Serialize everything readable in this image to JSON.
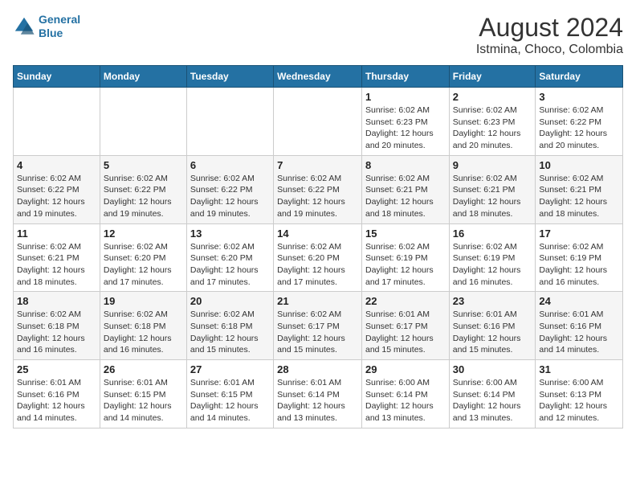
{
  "header": {
    "logo_line1": "General",
    "logo_line2": "Blue",
    "main_title": "August 2024",
    "subtitle": "Istmina, Choco, Colombia"
  },
  "calendar": {
    "days_of_week": [
      "Sunday",
      "Monday",
      "Tuesday",
      "Wednesday",
      "Thursday",
      "Friday",
      "Saturday"
    ],
    "weeks": [
      [
        {
          "day": "",
          "info": ""
        },
        {
          "day": "",
          "info": ""
        },
        {
          "day": "",
          "info": ""
        },
        {
          "day": "",
          "info": ""
        },
        {
          "day": "1",
          "info": "Sunrise: 6:02 AM\nSunset: 6:23 PM\nDaylight: 12 hours\nand 20 minutes."
        },
        {
          "day": "2",
          "info": "Sunrise: 6:02 AM\nSunset: 6:23 PM\nDaylight: 12 hours\nand 20 minutes."
        },
        {
          "day": "3",
          "info": "Sunrise: 6:02 AM\nSunset: 6:22 PM\nDaylight: 12 hours\nand 20 minutes."
        }
      ],
      [
        {
          "day": "4",
          "info": "Sunrise: 6:02 AM\nSunset: 6:22 PM\nDaylight: 12 hours\nand 19 minutes."
        },
        {
          "day": "5",
          "info": "Sunrise: 6:02 AM\nSunset: 6:22 PM\nDaylight: 12 hours\nand 19 minutes."
        },
        {
          "day": "6",
          "info": "Sunrise: 6:02 AM\nSunset: 6:22 PM\nDaylight: 12 hours\nand 19 minutes."
        },
        {
          "day": "7",
          "info": "Sunrise: 6:02 AM\nSunset: 6:22 PM\nDaylight: 12 hours\nand 19 minutes."
        },
        {
          "day": "8",
          "info": "Sunrise: 6:02 AM\nSunset: 6:21 PM\nDaylight: 12 hours\nand 18 minutes."
        },
        {
          "day": "9",
          "info": "Sunrise: 6:02 AM\nSunset: 6:21 PM\nDaylight: 12 hours\nand 18 minutes."
        },
        {
          "day": "10",
          "info": "Sunrise: 6:02 AM\nSunset: 6:21 PM\nDaylight: 12 hours\nand 18 minutes."
        }
      ],
      [
        {
          "day": "11",
          "info": "Sunrise: 6:02 AM\nSunset: 6:21 PM\nDaylight: 12 hours\nand 18 minutes."
        },
        {
          "day": "12",
          "info": "Sunrise: 6:02 AM\nSunset: 6:20 PM\nDaylight: 12 hours\nand 17 minutes."
        },
        {
          "day": "13",
          "info": "Sunrise: 6:02 AM\nSunset: 6:20 PM\nDaylight: 12 hours\nand 17 minutes."
        },
        {
          "day": "14",
          "info": "Sunrise: 6:02 AM\nSunset: 6:20 PM\nDaylight: 12 hours\nand 17 minutes."
        },
        {
          "day": "15",
          "info": "Sunrise: 6:02 AM\nSunset: 6:19 PM\nDaylight: 12 hours\nand 17 minutes."
        },
        {
          "day": "16",
          "info": "Sunrise: 6:02 AM\nSunset: 6:19 PM\nDaylight: 12 hours\nand 16 minutes."
        },
        {
          "day": "17",
          "info": "Sunrise: 6:02 AM\nSunset: 6:19 PM\nDaylight: 12 hours\nand 16 minutes."
        }
      ],
      [
        {
          "day": "18",
          "info": "Sunrise: 6:02 AM\nSunset: 6:18 PM\nDaylight: 12 hours\nand 16 minutes."
        },
        {
          "day": "19",
          "info": "Sunrise: 6:02 AM\nSunset: 6:18 PM\nDaylight: 12 hours\nand 16 minutes."
        },
        {
          "day": "20",
          "info": "Sunrise: 6:02 AM\nSunset: 6:18 PM\nDaylight: 12 hours\nand 15 minutes."
        },
        {
          "day": "21",
          "info": "Sunrise: 6:02 AM\nSunset: 6:17 PM\nDaylight: 12 hours\nand 15 minutes."
        },
        {
          "day": "22",
          "info": "Sunrise: 6:01 AM\nSunset: 6:17 PM\nDaylight: 12 hours\nand 15 minutes."
        },
        {
          "day": "23",
          "info": "Sunrise: 6:01 AM\nSunset: 6:16 PM\nDaylight: 12 hours\nand 15 minutes."
        },
        {
          "day": "24",
          "info": "Sunrise: 6:01 AM\nSunset: 6:16 PM\nDaylight: 12 hours\nand 14 minutes."
        }
      ],
      [
        {
          "day": "25",
          "info": "Sunrise: 6:01 AM\nSunset: 6:16 PM\nDaylight: 12 hours\nand 14 minutes."
        },
        {
          "day": "26",
          "info": "Sunrise: 6:01 AM\nSunset: 6:15 PM\nDaylight: 12 hours\nand 14 minutes."
        },
        {
          "day": "27",
          "info": "Sunrise: 6:01 AM\nSunset: 6:15 PM\nDaylight: 12 hours\nand 14 minutes."
        },
        {
          "day": "28",
          "info": "Sunrise: 6:01 AM\nSunset: 6:14 PM\nDaylight: 12 hours\nand 13 minutes."
        },
        {
          "day": "29",
          "info": "Sunrise: 6:00 AM\nSunset: 6:14 PM\nDaylight: 12 hours\nand 13 minutes."
        },
        {
          "day": "30",
          "info": "Sunrise: 6:00 AM\nSunset: 6:14 PM\nDaylight: 12 hours\nand 13 minutes."
        },
        {
          "day": "31",
          "info": "Sunrise: 6:00 AM\nSunset: 6:13 PM\nDaylight: 12 hours\nand 12 minutes."
        }
      ]
    ]
  }
}
